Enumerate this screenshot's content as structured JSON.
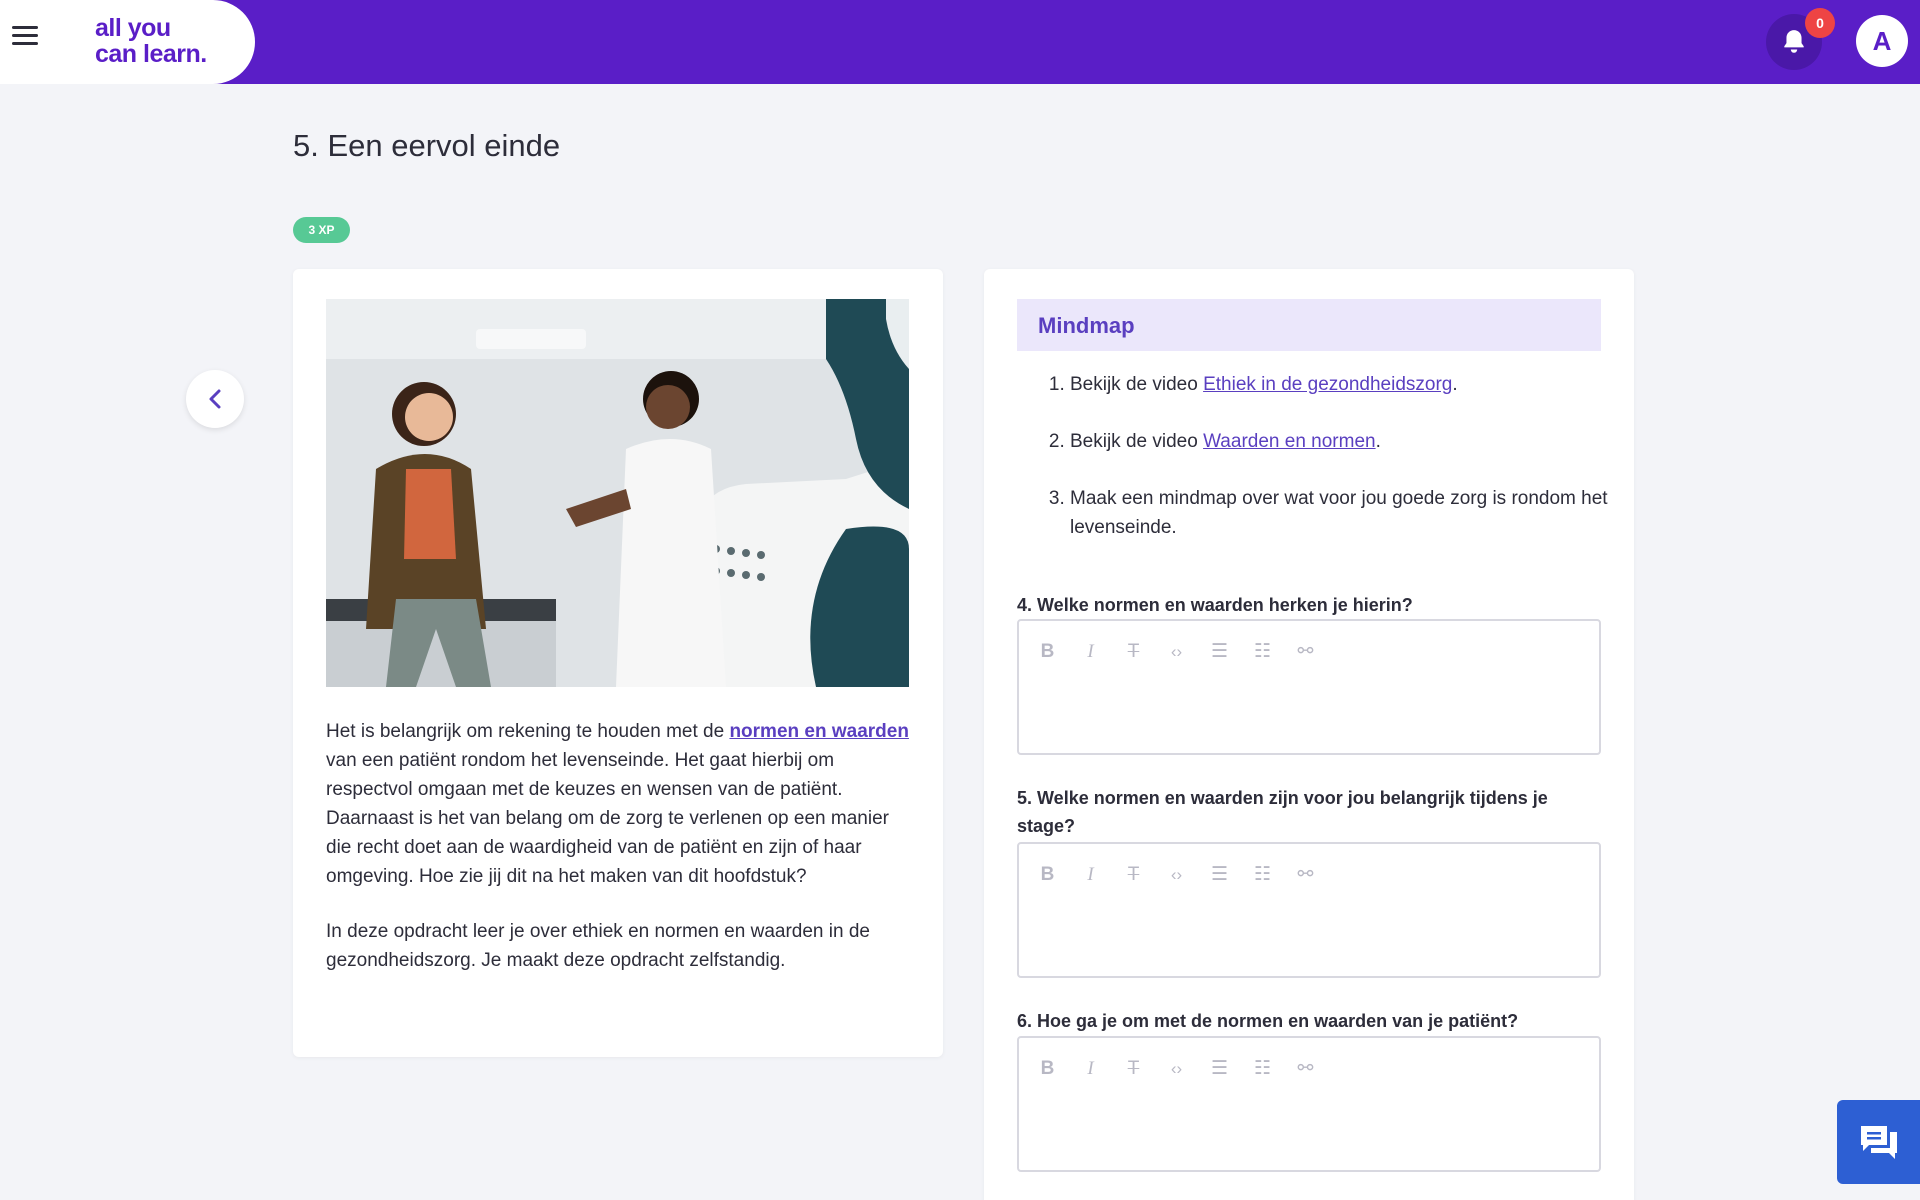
{
  "header": {
    "logo_line1": "all you",
    "logo_line2": "can learn.",
    "notification_count": "0",
    "avatar_initial": "A"
  },
  "page": {
    "title": "5. Een eervol einde",
    "xp": "3 XP"
  },
  "left_card": {
    "para1_before": "Het is belangrijk om rekening te houden met de ",
    "para1_link": "normen en waarden",
    "para1_after": " van een patiënt rondom het levenseinde. Het gaat hierbij om respectvol omgaan met de keuzes en wensen van de patiënt. Daarnaast is het van belang om de zorg te verlenen op een manier die recht doet aan de waardigheid van de patiënt en zijn of haar omgeving. Hoe zie jij dit na het maken van dit hoofdstuk?",
    "para2": "In deze opdracht leer je over ethiek en normen en waarden in de gezondheidszorg. Je maakt deze opdracht zelfstandig."
  },
  "right_card": {
    "heading": "Mindmap",
    "tasks": [
      {
        "before": "Bekijk de video ",
        "link": "Ethiek in de gezondheidszorg",
        "after": "."
      },
      {
        "before": "Bekijk de video ",
        "link": "Waarden en normen",
        "after": "."
      },
      {
        "before": "Maak een mindmap over wat voor jou goede zorg is rondom het levenseinde.",
        "link": "",
        "after": ""
      }
    ],
    "questions": [
      "4. Welke normen en waarden herken je hierin?",
      "5. Welke normen en waarden zijn voor jou belangrijk tijdens je stage?",
      "6. Hoe ga je om met de normen en waarden van je patiënt?"
    ],
    "toolbar_icons": [
      "bold-icon",
      "italic-icon",
      "strikethrough-icon",
      "code-icon",
      "bullet-list-icon",
      "numbered-list-icon",
      "link-icon"
    ]
  },
  "colors": {
    "brand": "#5a1ec7",
    "accent_link": "#5a3fc0",
    "xp_green": "#57c995",
    "badge_red": "#ee4444",
    "chat_blue": "#2d5fd3"
  }
}
